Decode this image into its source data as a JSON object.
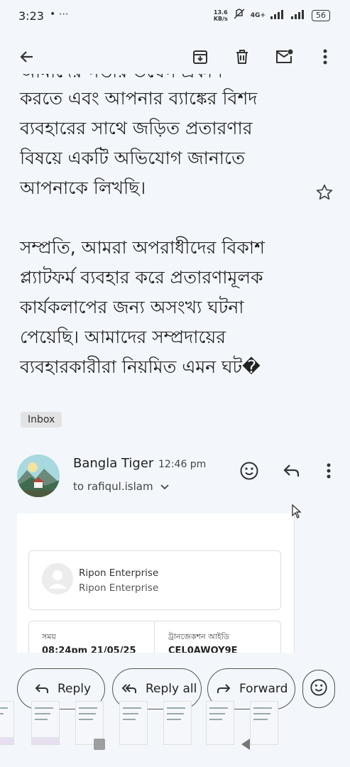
{
  "status_bar": {
    "time": "3:23",
    "left_icons": "• ⋯",
    "speed_value": "13.6",
    "speed_unit": "KB/s",
    "network": "4G+",
    "battery": "56"
  },
  "toolbar": {
    "back_icon": "arrow-left-icon",
    "archive_icon": "archive-icon",
    "delete_icon": "trash-icon",
    "mark_unread_icon": "mail-unread-icon",
    "more_icon": "more-vertical-icon"
  },
  "email": {
    "clipped_top_line": "আমাদের গভীর উদ্বেগ প্রকাশ",
    "paragraph1": [
      "করতে এবং আপনার ব্যাঙ্কের বিশদ",
      "ব্যবহারের সাথে জড়িত প্রতারণার",
      "বিষয়ে একটি অভিযোগ জানাতে",
      "আপনাকে লিখছি।"
    ],
    "paragraph2": [
      "সম্প্রতি, আমরা অপরাধীদের বিকাশ",
      "প্ল্যাটফর্ম ব্যবহার করে প্রতারণামূলক",
      "কার্যকলাপের জন্য অসংখ্য ঘটনা",
      "পেয়েছি। আমাদের সম্প্রদায়ের",
      "ব্যবহারকারীরা নিয়মিত এমন ঘট�"
    ],
    "label": "Inbox"
  },
  "reply_message": {
    "sender": "Bangla Tiger",
    "time": "12:46 pm",
    "to": "to rafiqul.islam"
  },
  "receipt": {
    "merchant_name": "Ripon Enterprise",
    "merchant_sub": "Ripon Enterprise",
    "time_label": "সময়",
    "time_value": "08:24pm 21/05/25",
    "txn_label": "ট্রানজেকশন আইডি",
    "txn_value": "CEL0AWOY9E"
  },
  "actions": {
    "reply": "Reply",
    "reply_all": "Reply all",
    "forward": "Forward"
  },
  "colors": {
    "background": "#f3f7fb",
    "text": "#1f1f1f",
    "chip": "#e3e3e3"
  }
}
